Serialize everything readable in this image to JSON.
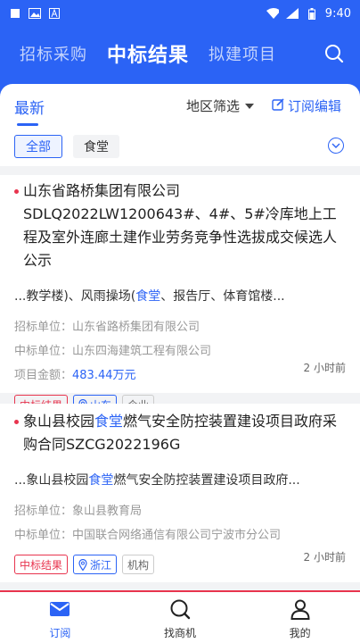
{
  "status_bar": {
    "time": "9:40"
  },
  "top_tabs": [
    {
      "label": "招标采购"
    },
    {
      "label": "中标结果"
    },
    {
      "label": "拟建项目"
    }
  ],
  "filter_bar": {
    "active_tab": "最新",
    "region_filter": "地区筛选",
    "subscription_edit": "订阅编辑"
  },
  "chips": [
    {
      "label": "全部"
    },
    {
      "label": "食堂"
    }
  ],
  "cards": [
    {
      "title_pre": "山东省路桥集团有限公司SDLQ2022LW1200643#、4#、5#冷库地上工程及室外连廊土建作业劳务竞争性选拔成交候选人公示",
      "snippet_pre": "...教学楼)、风雨操场(",
      "snippet_hl": "食堂",
      "snippet_post": "、报告厅、体育馆楼...",
      "tenderer_label": "招标单位：",
      "tenderer": "山东省路桥集团有限公司",
      "winner_label": "中标单位：",
      "winner": "山东四海建筑工程有限公司",
      "amount_label": "项目金额：",
      "amount": "483.44万元",
      "tag_type": "中标结果",
      "tag_region": "山东",
      "tag_kind": "企业",
      "time": "2 小时前"
    },
    {
      "title_pre": "象山县校园",
      "title_hl": "食堂",
      "title_post": "燃气安全防控装置建设项目政府采购合同SZCG2022196G",
      "snippet_pre": "...象山县校园",
      "snippet_hl": "食堂",
      "snippet_post": "燃气安全防控装置建设项目政府...",
      "tenderer_label": "招标单位：",
      "tenderer": "象山县教育局",
      "winner_label": "中标单位：",
      "winner": "中国联合网络通信有限公司宁波市分公司",
      "tag_type": "中标结果",
      "tag_region": "浙江",
      "tag_kind": "机构",
      "time": "2 小时前"
    }
  ],
  "bottom_nav": [
    {
      "label": "订阅"
    },
    {
      "label": "找商机"
    },
    {
      "label": "我的"
    }
  ],
  "colors": {
    "brand": "#2b63f5",
    "accent_red": "#e8344e"
  },
  "icons": [
    "image-icon",
    "font-icon",
    "wifi-icon",
    "signal-icon",
    "battery-icon",
    "search-icon",
    "edit-icon",
    "chevron-down-icon",
    "location-pin-icon",
    "mail-icon",
    "user-icon"
  ]
}
